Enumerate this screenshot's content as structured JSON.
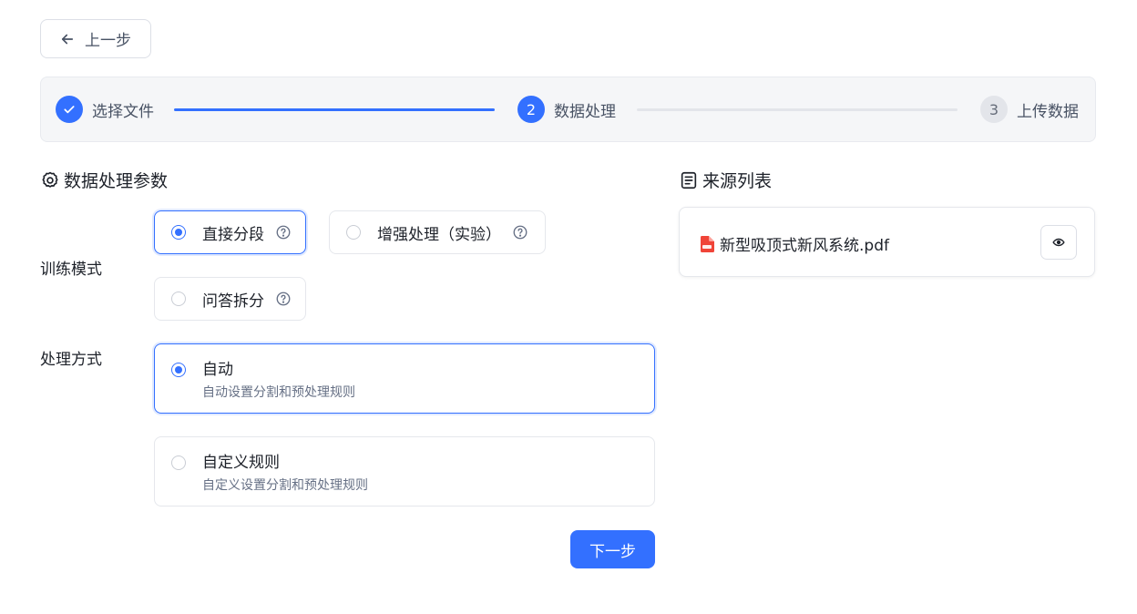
{
  "back_button": {
    "label": "上一步"
  },
  "steps": [
    {
      "number": "1",
      "label": "选择文件",
      "state": "done"
    },
    {
      "number": "2",
      "label": "数据处理",
      "state": "active"
    },
    {
      "number": "3",
      "label": "上传数据",
      "state": "pending"
    }
  ],
  "params": {
    "title": "数据处理参数",
    "training_mode": {
      "label": "训练模式",
      "options": [
        {
          "label": "直接分段",
          "selected": true
        },
        {
          "label": "增强处理（实验）",
          "selected": false
        },
        {
          "label": "问答拆分",
          "selected": false
        }
      ]
    },
    "process_method": {
      "label": "处理方式",
      "options": [
        {
          "title": "自动",
          "desc": "自动设置分割和预处理规则",
          "selected": true
        },
        {
          "title": "自定义规则",
          "desc": "自定义设置分割和预处理规则",
          "selected": false
        }
      ]
    },
    "next_button": "下一步"
  },
  "sources": {
    "title": "来源列表",
    "files": [
      {
        "name": "新型吸顶式新风系统.pdf",
        "icon": "pdf-icon"
      }
    ]
  },
  "colors": {
    "accent": "#3370ff",
    "pdf": "#f04438"
  }
}
